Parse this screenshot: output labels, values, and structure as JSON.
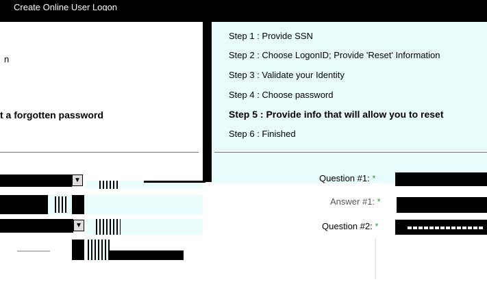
{
  "window": {
    "title": "Create Online User Logon"
  },
  "left": {
    "line1": "n",
    "line2": "t a forgotten password"
  },
  "steps": [
    {
      "label": "Step 1 : Provide SSN",
      "active": false
    },
    {
      "label": "Step 2 : Choose LogonID; Provide 'Reset' Information",
      "active": false
    },
    {
      "label": "Step 3 : Validate your Identity",
      "active": false
    },
    {
      "label": "Step 4 : Choose password",
      "active": false
    },
    {
      "label": "Step 5 : Provide info that will allow you to reset",
      "active": true
    },
    {
      "label": "Step 6 : Finished",
      "active": false
    }
  ],
  "form": {
    "question1_label": "Question #1:",
    "answer1_label": "Answer #1:",
    "question2_label": "Question #2:",
    "required_mark": "*"
  },
  "icons": {
    "select_arrow": "chevron-down-icon"
  }
}
